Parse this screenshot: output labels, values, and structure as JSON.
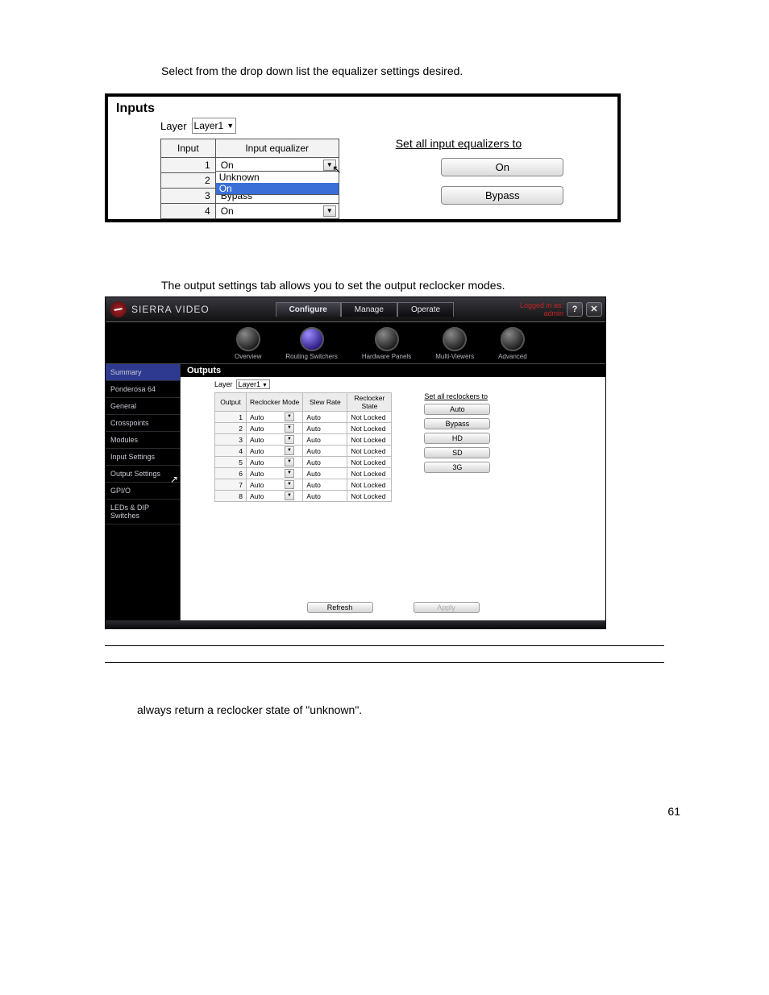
{
  "intro_text": "Select from the drop down list the equalizer settings desired.",
  "mid_text": "The output settings tab allows you to set the output reclocker modes.",
  "bottom_note": "always return a reclocker state of \"unknown\".",
  "page_number": "61",
  "inputs": {
    "title": "Inputs",
    "layer_label": "Layer",
    "layer_value": "Layer1",
    "columns": {
      "input": "Input",
      "eq": "Input equalizer"
    },
    "rows": [
      {
        "idx": "1",
        "eq": "On",
        "open": true
      },
      {
        "idx": "2",
        "eq": "On"
      },
      {
        "idx": "3",
        "eq": "Bypass"
      },
      {
        "idx": "4",
        "eq": "On"
      }
    ],
    "dropdown_options": {
      "unknown": "Unknown",
      "on": "On"
    },
    "set_all_label": "Set all input equalizers to",
    "btn_on": "On",
    "btn_bypass": "Bypass"
  },
  "app": {
    "brand": "SIERRA VIDEO",
    "tabs": {
      "configure": "Configure",
      "manage": "Manage",
      "operate": "Operate"
    },
    "logged_in_label": "Logged in as:",
    "logged_in_user": "admin",
    "help_icon": "?",
    "logout_icon": "✕",
    "subnav": {
      "overview": "Overview",
      "routing": "Routing Switchers",
      "hardware": "Hardware Panels",
      "multi": "Multi-Viewers",
      "advanced": "Advanced"
    },
    "sidebar": {
      "summary": "Summary",
      "ponderosa": "Ponderosa 64",
      "general": "General",
      "crosspoints": "Crosspoints",
      "modules": "Modules",
      "input_settings": "Input Settings",
      "output_settings": "Output Settings",
      "gpio": "GPI/O",
      "leds": "LEDs & DIP Switches"
    },
    "outputs": {
      "title": "Outputs",
      "layer_label": "Layer",
      "layer_value": "Layer1",
      "columns": {
        "output": "Output",
        "mode": "Reclocker Mode",
        "slew": "Slew Rate",
        "state": "Reclocker State"
      },
      "rows": [
        {
          "idx": "1",
          "mode": "Auto",
          "slew": "Auto",
          "state": "Not Locked"
        },
        {
          "idx": "2",
          "mode": "Auto",
          "slew": "Auto",
          "state": "Not Locked"
        },
        {
          "idx": "3",
          "mode": "Auto",
          "slew": "Auto",
          "state": "Not Locked"
        },
        {
          "idx": "4",
          "mode": "Auto",
          "slew": "Auto",
          "state": "Not Locked"
        },
        {
          "idx": "5",
          "mode": "Auto",
          "slew": "Auto",
          "state": "Not Locked"
        },
        {
          "idx": "6",
          "mode": "Auto",
          "slew": "Auto",
          "state": "Not Locked"
        },
        {
          "idx": "7",
          "mode": "Auto",
          "slew": "Auto",
          "state": "Not Locked"
        },
        {
          "idx": "8",
          "mode": "Auto",
          "slew": "Auto",
          "state": "Not Locked"
        }
      ],
      "set_all_label": "Set all reclockers to",
      "btns": {
        "auto": "Auto",
        "bypass": "Bypass",
        "hd": "HD",
        "sd": "SD",
        "threeg": "3G"
      },
      "refresh": "Refresh",
      "apply": "Apply"
    }
  }
}
